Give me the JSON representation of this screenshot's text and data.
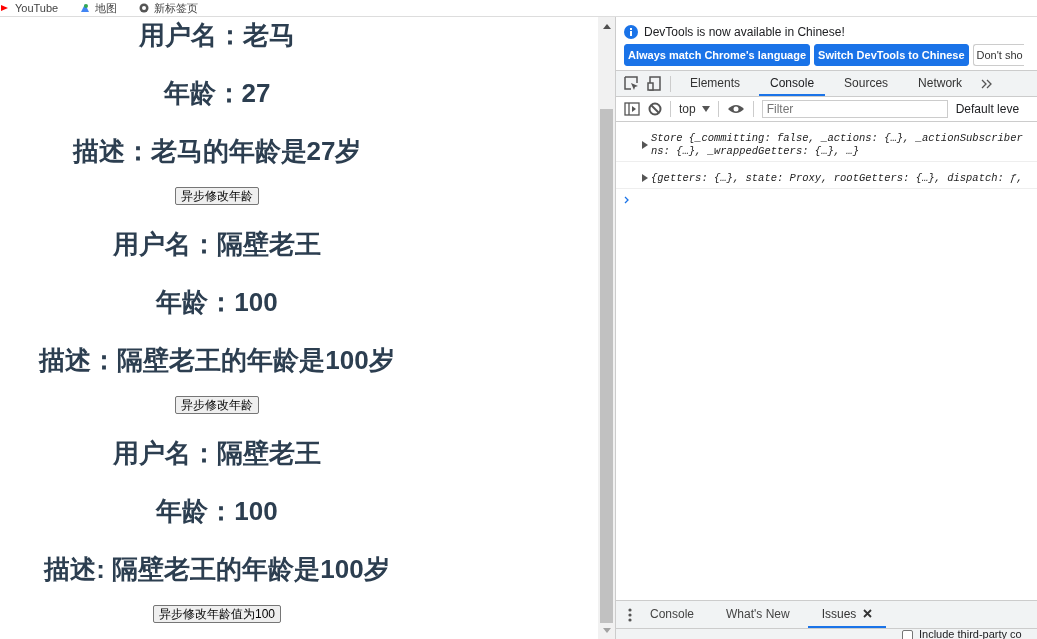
{
  "bookmarks": [
    {
      "label": "YouTube"
    },
    {
      "label": "地图"
    },
    {
      "label": "新标签页"
    }
  ],
  "page": {
    "sections": [
      {
        "lines": [
          "用户名：老马",
          "年龄：27",
          "描述：老马的年龄是27岁"
        ],
        "button": "异步修改年龄"
      },
      {
        "lines": [
          "用户名：隔壁老王",
          "年龄：100",
          "描述：隔壁老王的年龄是100岁"
        ],
        "button": "异步修改年龄"
      },
      {
        "lines": [
          "用户名：隔壁老王",
          "年龄：100",
          "描述: 隔壁老王的年龄是100岁"
        ],
        "button": "异步修改年龄值为100"
      }
    ]
  },
  "devtools": {
    "notice": "DevTools is now available in Chinese!",
    "notice_buttons": [
      {
        "label": "Always match Chrome's language",
        "kind": "primary"
      },
      {
        "label": "Switch DevTools to Chinese",
        "kind": "primary"
      },
      {
        "label": "Don't sho",
        "kind": "plain"
      }
    ],
    "tabs": [
      {
        "label": "Elements",
        "selected": false
      },
      {
        "label": "Console",
        "selected": true
      },
      {
        "label": "Sources",
        "selected": false
      },
      {
        "label": "Network",
        "selected": false
      }
    ],
    "context": "top",
    "filter_placeholder": "Filter",
    "levels": "Default leve",
    "messages": [
      {
        "lines": [
          "Store {_committing: false, _actions: {…}, _actionSubscriber",
          "ns: {…}, _wrappedGetters: {…}, …}"
        ]
      },
      {
        "lines": [
          "{getters: {…}, state: Proxy, rootGetters: {…}, dispatch: ƒ,"
        ]
      }
    ],
    "drawer_tabs": [
      {
        "label": "Console",
        "selected": false,
        "closable": false
      },
      {
        "label": "What's New",
        "selected": false,
        "closable": false
      },
      {
        "label": "Issues",
        "selected": true,
        "closable": true
      }
    ],
    "third_party": {
      "label": "Include third-party co",
      "checked": false
    }
  }
}
